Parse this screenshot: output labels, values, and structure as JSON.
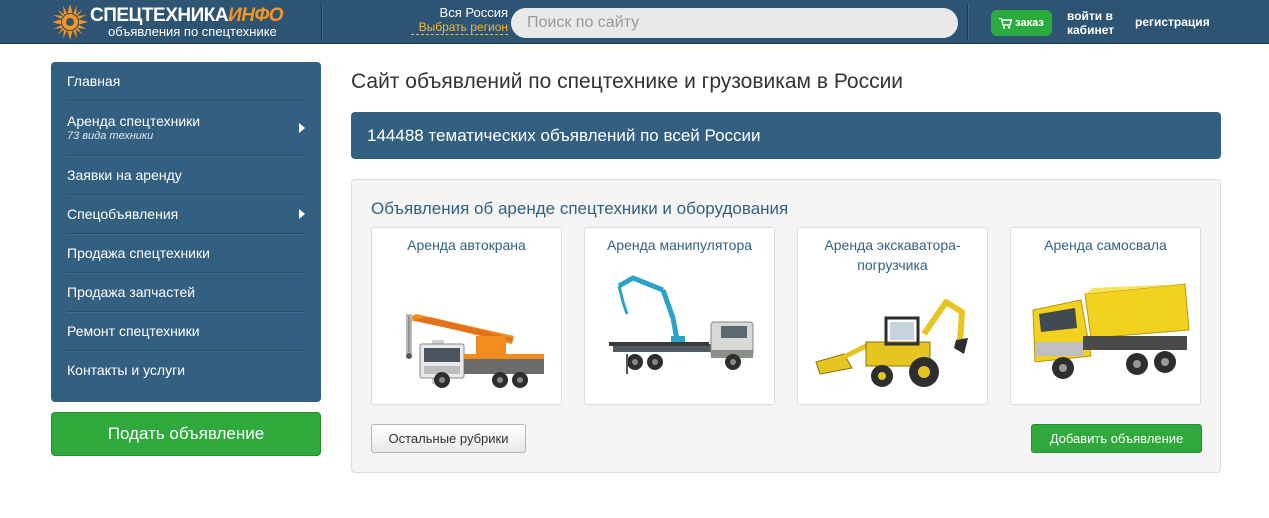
{
  "header": {
    "logo_main": "СПЕЦТЕХНИКА",
    "logo_accent": "ИНФО",
    "logo_sub": "объявления по спецтехнике",
    "region_name": "Вся Россия",
    "region_link": "Выбрать регион",
    "search_placeholder": "Поиск по сайту",
    "order_label": "заказ",
    "login_label": "войти в кабинет",
    "register_label": "регистрация",
    "colors": {
      "bar": "#2d5472",
      "accent": "#f7941d",
      "green": "#2bab3e"
    }
  },
  "sidebar": {
    "items": [
      {
        "label": "Главная",
        "sub": "",
        "arrow": false
      },
      {
        "label": "Аренда спецтехники",
        "sub": "73 вида техники",
        "arrow": true
      },
      {
        "label": "Заявки на аренду",
        "sub": "",
        "arrow": false
      },
      {
        "label": "Спецобъявления",
        "sub": "",
        "arrow": true
      },
      {
        "label": "Продажа спецтехники",
        "sub": "",
        "arrow": false
      },
      {
        "label": "Продажа запчастей",
        "sub": "",
        "arrow": false
      },
      {
        "label": "Ремонт спецтехники",
        "sub": "",
        "arrow": false
      },
      {
        "label": "Контакты и услуги",
        "sub": "",
        "arrow": false
      }
    ],
    "post_button": "Подать объявление"
  },
  "main": {
    "title": "Сайт объявлений по спецтехнике и грузовикам в России",
    "count_text": "144488 тематических объявлений по всей России",
    "panel_title": "Объявления об аренде спецтехники и оборудования",
    "cards": [
      {
        "title": "Аренда автокрана",
        "icon": "truck-crane-image"
      },
      {
        "title": "Аренда манипулятора",
        "icon": "manipulator-truck-image"
      },
      {
        "title": "Аренда экскаватора-погрузчика",
        "icon": "backhoe-loader-image"
      },
      {
        "title": "Аренда самосвала",
        "icon": "dump-truck-image"
      }
    ],
    "other_button": "Остальные рубрики",
    "add_button": "Добавить объявление"
  }
}
